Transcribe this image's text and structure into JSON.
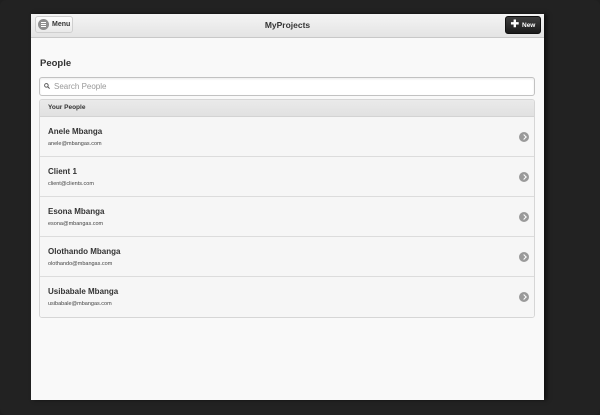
{
  "header": {
    "menu_label": "Menu",
    "title": "MyProjects",
    "new_label": "New"
  },
  "page": {
    "title": "People"
  },
  "search": {
    "placeholder": "Search People",
    "value": ""
  },
  "list": {
    "header": "Your People",
    "people": [
      {
        "name": "Anele Mbanga",
        "email": "anele@mbangas.com"
      },
      {
        "name": "Client 1",
        "email": "client@clients.com"
      },
      {
        "name": "Esona Mbanga",
        "email": "esona@mbangas.com"
      },
      {
        "name": "Olothando Mbanga",
        "email": "olothando@mbangas.com"
      },
      {
        "name": "Usibabale Mbanga",
        "email": "usibabale@mbangas.com"
      }
    ]
  },
  "icons": {
    "menu": "menu-icon",
    "new": "plus-icon",
    "search": "search-icon",
    "row_arrow": "chevron-right-icon"
  },
  "colors": {
    "device_frame": "#222222",
    "screen_bg": "#f9f9f9",
    "new_button": "#1b1b1b"
  }
}
